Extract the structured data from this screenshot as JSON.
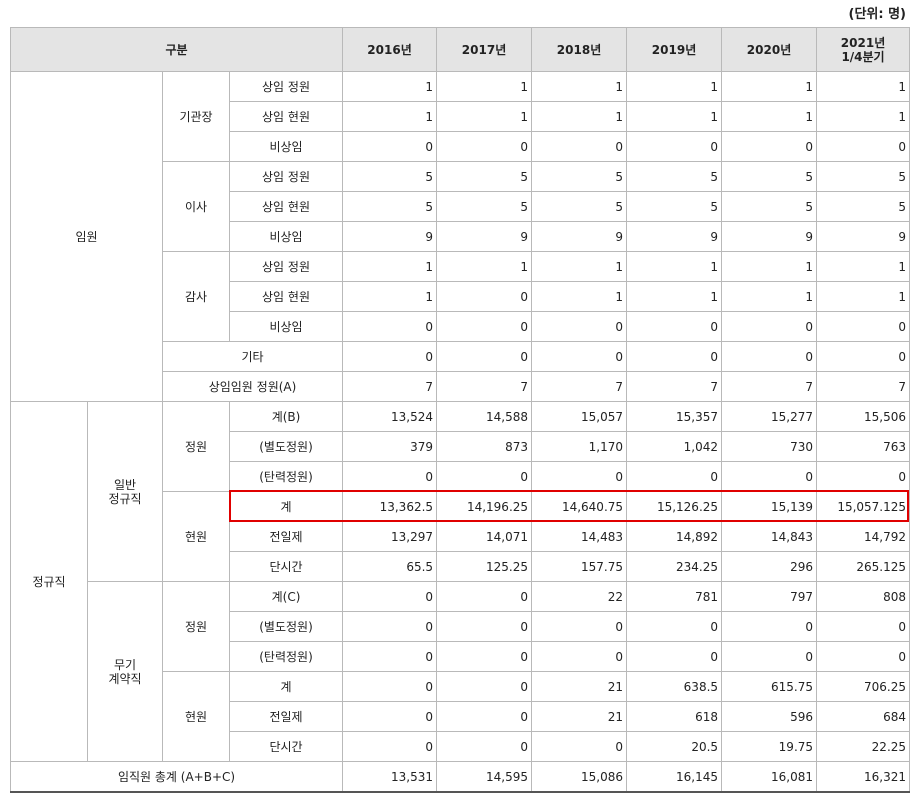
{
  "unit_label": "(단위: 명)",
  "header": {
    "category": "구분",
    "years": [
      "2016년",
      "2017년",
      "2018년",
      "2019년",
      "2020년",
      "2021년\n1/4분기"
    ]
  },
  "labels": {
    "executives": "임원",
    "head": "기관장",
    "director": "이사",
    "auditor": "감사",
    "fulltime_quota": "상임 정원",
    "fulltime_current": "상임 현원",
    "nonstanding": "비상임",
    "other": "기타",
    "fulltime_exec_quota_a": "상임임원 정원(A)",
    "regular": "정규직",
    "general_regular": "일반\n정규직",
    "quota": "정원",
    "current": "현원",
    "total_b": "계(B)",
    "separate_quota": "(별도정원)",
    "flexible_quota": "(탄력정원)",
    "total": "계",
    "fulltime": "전일제",
    "parttime": "단시간",
    "indefinite": "무기\n계약직",
    "total_c": "계(C)",
    "grand_total": "임직원 총계 (A+B+C)"
  },
  "rows": {
    "head_quota": [
      "1",
      "1",
      "1",
      "1",
      "1",
      "1"
    ],
    "head_current": [
      "1",
      "1",
      "1",
      "1",
      "1",
      "1"
    ],
    "head_nonstanding": [
      "0",
      "0",
      "0",
      "0",
      "0",
      "0"
    ],
    "dir_quota": [
      "5",
      "5",
      "5",
      "5",
      "5",
      "5"
    ],
    "dir_current": [
      "5",
      "5",
      "5",
      "5",
      "5",
      "5"
    ],
    "dir_nonstanding": [
      "9",
      "9",
      "9",
      "9",
      "9",
      "9"
    ],
    "aud_quota": [
      "1",
      "1",
      "1",
      "1",
      "1",
      "1"
    ],
    "aud_current": [
      "1",
      "0",
      "1",
      "1",
      "1",
      "1"
    ],
    "aud_nonstanding": [
      "0",
      "0",
      "0",
      "0",
      "0",
      "0"
    ],
    "other": [
      "0",
      "0",
      "0",
      "0",
      "0",
      "0"
    ],
    "exec_quota_a": [
      "7",
      "7",
      "7",
      "7",
      "7",
      "7"
    ],
    "gen_quota_total_b": [
      "13,524",
      "14,588",
      "15,057",
      "15,357",
      "15,277",
      "15,506"
    ],
    "gen_quota_separate": [
      "379",
      "873",
      "1,170",
      "1,042",
      "730",
      "763"
    ],
    "gen_quota_flexible": [
      "0",
      "0",
      "0",
      "0",
      "0",
      "0"
    ],
    "gen_current_total": [
      "13,362.5",
      "14,196.25",
      "14,640.75",
      "15,126.25",
      "15,139",
      "15,057.125"
    ],
    "gen_current_fulltime": [
      "13,297",
      "14,071",
      "14,483",
      "14,892",
      "14,843",
      "14,792"
    ],
    "gen_current_parttime": [
      "65.5",
      "125.25",
      "157.75",
      "234.25",
      "296",
      "265.125"
    ],
    "ind_quota_total_c": [
      "0",
      "0",
      "22",
      "781",
      "797",
      "808"
    ],
    "ind_quota_separate": [
      "0",
      "0",
      "0",
      "0",
      "0",
      "0"
    ],
    "ind_quota_flexible": [
      "0",
      "0",
      "0",
      "0",
      "0",
      "0"
    ],
    "ind_current_total": [
      "0",
      "0",
      "21",
      "638.5",
      "615.75",
      "706.25"
    ],
    "ind_current_fulltime": [
      "0",
      "0",
      "21",
      "618",
      "596",
      "684"
    ],
    "ind_current_parttime": [
      "0",
      "0",
      "0",
      "20.5",
      "19.75",
      "22.25"
    ],
    "grand_total": [
      "13,531",
      "14,595",
      "15,086",
      "16,145",
      "16,081",
      "16,321"
    ]
  },
  "highlight_color": "#e00000"
}
